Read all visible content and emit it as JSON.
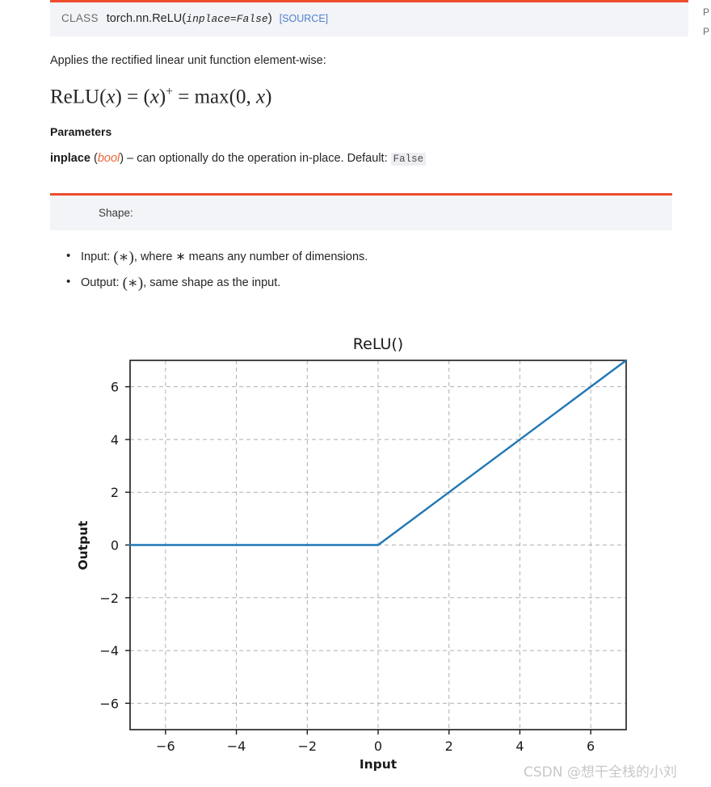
{
  "theme": {
    "accent": "#ee4c2c",
    "panel_bg": "#f3f4f7",
    "link": "#4f7fd0",
    "type_color": "#e8663a",
    "line_color": "#1f77b4",
    "text": "#262626"
  },
  "signature": {
    "class_keyword": "CLASS",
    "qualified_name": "torch.nn.ReLU",
    "open_paren": "(",
    "arg": "inplace=False",
    "close_paren": ")",
    "source_link": "[SOURCE]"
  },
  "description": {
    "intro": "Applies the rectified linear unit function element-wise:",
    "formula_plain": "ReLU(x) = (x)+ = max(0, x)",
    "formula": {
      "fn": "ReLU",
      "lparen": "(",
      "x1": "x",
      "rparen": ")",
      "eq1": "=",
      "lparen2": "(",
      "x2": "x",
      "rparen2": ")",
      "plus": "+",
      "eq2": "=",
      "max": "max",
      "lparen3": "(",
      "zero": "0",
      "comma": ",",
      "x3": "x",
      "rparen3": ")"
    }
  },
  "parameters": {
    "heading": "Parameters",
    "items": [
      {
        "name": "inplace",
        "type_open": "(",
        "type": "bool",
        "type_close": ")",
        "dash": "–",
        "desc": "can optionally do the operation in-place. Default:",
        "default_value": "False"
      }
    ]
  },
  "shape": {
    "title": "Shape:",
    "items": [
      {
        "prefix": "Input:",
        "tensor": "(∗)",
        "suffix": ", where ∗ means any number of dimensions."
      },
      {
        "prefix": "Output:",
        "tensor": "(∗)",
        "suffix": ", same shape as the input."
      }
    ]
  },
  "watermark": "CSDN @想干全栈的小刘",
  "edge_fragments": {
    "frag1": "P",
    "frag2": "P"
  },
  "chart_data": {
    "type": "line",
    "title": "ReLU()",
    "xlabel": "Input",
    "ylabel": "Output",
    "xlim": [
      -7,
      7
    ],
    "ylim": [
      -7,
      7
    ],
    "xticks": [
      -6,
      -4,
      -2,
      0,
      2,
      4,
      6
    ],
    "yticks": [
      -6,
      -4,
      -2,
      0,
      2,
      4,
      6
    ],
    "xticklabels": [
      "−6",
      "−4",
      "−2",
      "0",
      "2",
      "4",
      "6"
    ],
    "yticklabels": [
      "−6",
      "−4",
      "−2",
      "0",
      "2",
      "4",
      "6"
    ],
    "grid": true,
    "grid_style": "dashed",
    "legend": null,
    "series": [
      {
        "name": "ReLU",
        "color": "#1f77b4",
        "linewidth": 2.4,
        "x": [
          -7,
          -6,
          -5,
          -4,
          -3,
          -2,
          -1,
          0,
          1,
          2,
          3,
          4,
          5,
          6,
          7
        ],
        "y": [
          0,
          0,
          0,
          0,
          0,
          0,
          0,
          0,
          1,
          2,
          3,
          4,
          5,
          6,
          7
        ]
      }
    ]
  }
}
